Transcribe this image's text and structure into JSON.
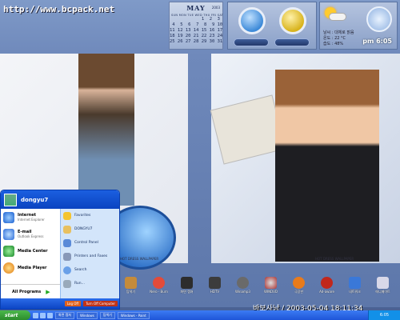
{
  "watermark": "http://www.bcpack.net",
  "calendar": {
    "month": "MAY",
    "year": "2003",
    "weekdays": "SUN MON TUE WED THU FRI SAT",
    "weeks": [
      "            1  2  3",
      " 4  5  6  7  8  9 10",
      "11 12 13 14 15 16 17",
      "18 19 20 21 22 23 24",
      "25 26 27 28 29 30 31"
    ]
  },
  "weather": {
    "line1": "날씨 : 대체로 맑음",
    "line2": "온도 : 22 °C",
    "line3": "습도 : 48%"
  },
  "clock": {
    "time": "pm 6:05"
  },
  "photos": {
    "caption_left": "HOT DRESS WALLPAPER",
    "caption_right": "HOT DRESS WALLPAPER"
  },
  "start_menu": {
    "user": "dongyu7",
    "left_items": [
      {
        "title": "Internet",
        "sub": "Internet Explorer",
        "icon": "internet-explorer-icon"
      },
      {
        "title": "E-mail",
        "sub": "Outlook Express",
        "icon": "outlook-express-icon"
      },
      {
        "title": "Media Center",
        "sub": "",
        "icon": "media-center-icon"
      },
      {
        "title": "Media Player",
        "sub": "",
        "icon": "media-player-icon"
      }
    ],
    "all_programs": "All Programs",
    "right_items": [
      {
        "label": "Favorites",
        "icon": "favorites-icon"
      },
      {
        "label": "DONGYU7",
        "icon": "user-folder-icon"
      },
      {
        "label": "Control Panel",
        "icon": "control-panel-icon"
      },
      {
        "label": "Printers and Faxes",
        "icon": "printer-icon"
      },
      {
        "label": "Search",
        "icon": "search-icon"
      },
      {
        "label": "Run...",
        "icon": "run-icon"
      }
    ],
    "logoff": "Log Off",
    "turnoff": "Turn Off Computer"
  },
  "desktop_icons": [
    {
      "label": "탐색기",
      "icon": "explorer-icon",
      "color": "#c58b3a"
    },
    {
      "label": "Nero - Burn",
      "icon": "nero-icon",
      "color": "#e24b3a"
    },
    {
      "label": "화면 캡쳐",
      "icon": "capture-icon",
      "color": "#2d2d2d"
    },
    {
      "label": "HDTV",
      "icon": "hdtv-icon",
      "color": "#3c3c3c"
    },
    {
      "label": "Winamp3",
      "icon": "winamp-icon",
      "color": "#6a6a6a"
    },
    {
      "label": "WINDVD",
      "icon": "windvd-icon",
      "color": "#aa3333"
    },
    {
      "label": "극장판",
      "icon": "fish-icon",
      "color": "#e87b1c"
    },
    {
      "label": "Ad-aware",
      "icon": "adaware-icon",
      "color": "#c1271c"
    },
    {
      "label": "네트워크",
      "icon": "network-icon",
      "color": "#3a78d8"
    },
    {
      "label": "애니메이트",
      "icon": "anime-icon",
      "color": "#d8d8e8"
    }
  ],
  "stamp": "바보사냥 / 2003-05-04 18:11:34",
  "taskbar": {
    "start": "start",
    "buttons": [
      "화면 캡쳐",
      "Windows",
      "탐색기",
      "Windows - Paint"
    ],
    "tray_time": "6:05"
  }
}
